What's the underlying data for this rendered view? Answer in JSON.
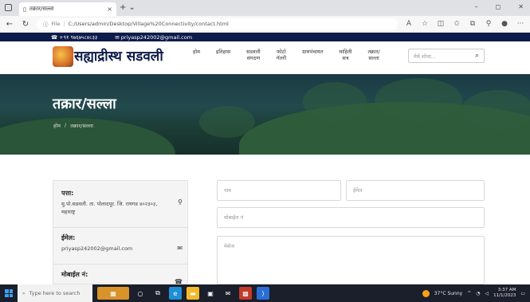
{
  "browser": {
    "tab_title": "तक्रार/सल्ला",
    "tab_close": "×",
    "new_tab": "+  ⌄",
    "url_prefix": "File",
    "url": "C:/Users/admin/Desktop/Village%20Connectivity/contact.html",
    "window_controls": [
      "–",
      "◻",
      "✕"
    ]
  },
  "topbar": {
    "phone": "+९१ ९७६७५८४८३३",
    "email": "priyasp242002@gmail.com"
  },
  "header": {
    "brand": "सह्याद्रीस्थ सडवली",
    "menu": [
      {
        "line1": "होम",
        "line2": ""
      },
      {
        "line1": "इतिहास",
        "line2": ""
      },
      {
        "line1": "सडवली",
        "line2": "संगठण"
      },
      {
        "line1": "फोटो",
        "line2": "गॅलरी"
      },
      {
        "line1": "ग्रामपंचायत",
        "line2": ""
      },
      {
        "line1": "माहिती",
        "line2": "सत्र"
      },
      {
        "line1": "तक्रार/",
        "line2": "सल्ला"
      }
    ],
    "search_placeholder": "येथे शोधा..."
  },
  "hero": {
    "title": "तक्रार/सल्ला",
    "breadcrumb_home": "होम",
    "breadcrumb_sep": "/",
    "breadcrumb_current": "तक्रार/सल्ला"
  },
  "info": {
    "address_label": "पत्ता:",
    "address_value": "मु.पो.सडवली. ता. पोलादपूर. जि. रायगड ४०२३०३, महाराष्ट्र",
    "email_label": "ईमेल:",
    "email_value": "priyasp242002@gmail.com",
    "mobile_label": "मोबाईल नं:"
  },
  "form": {
    "name_placeholder": "नाव",
    "email_placeholder": "ईमेल",
    "mobile_placeholder": "मोबाईल नं",
    "message_placeholder": "मेसेज"
  },
  "taskbar": {
    "search_placeholder": "Type here to search",
    "weather": "37°C Sunny",
    "time": "3:37 AM",
    "date": "11/1/2023"
  }
}
